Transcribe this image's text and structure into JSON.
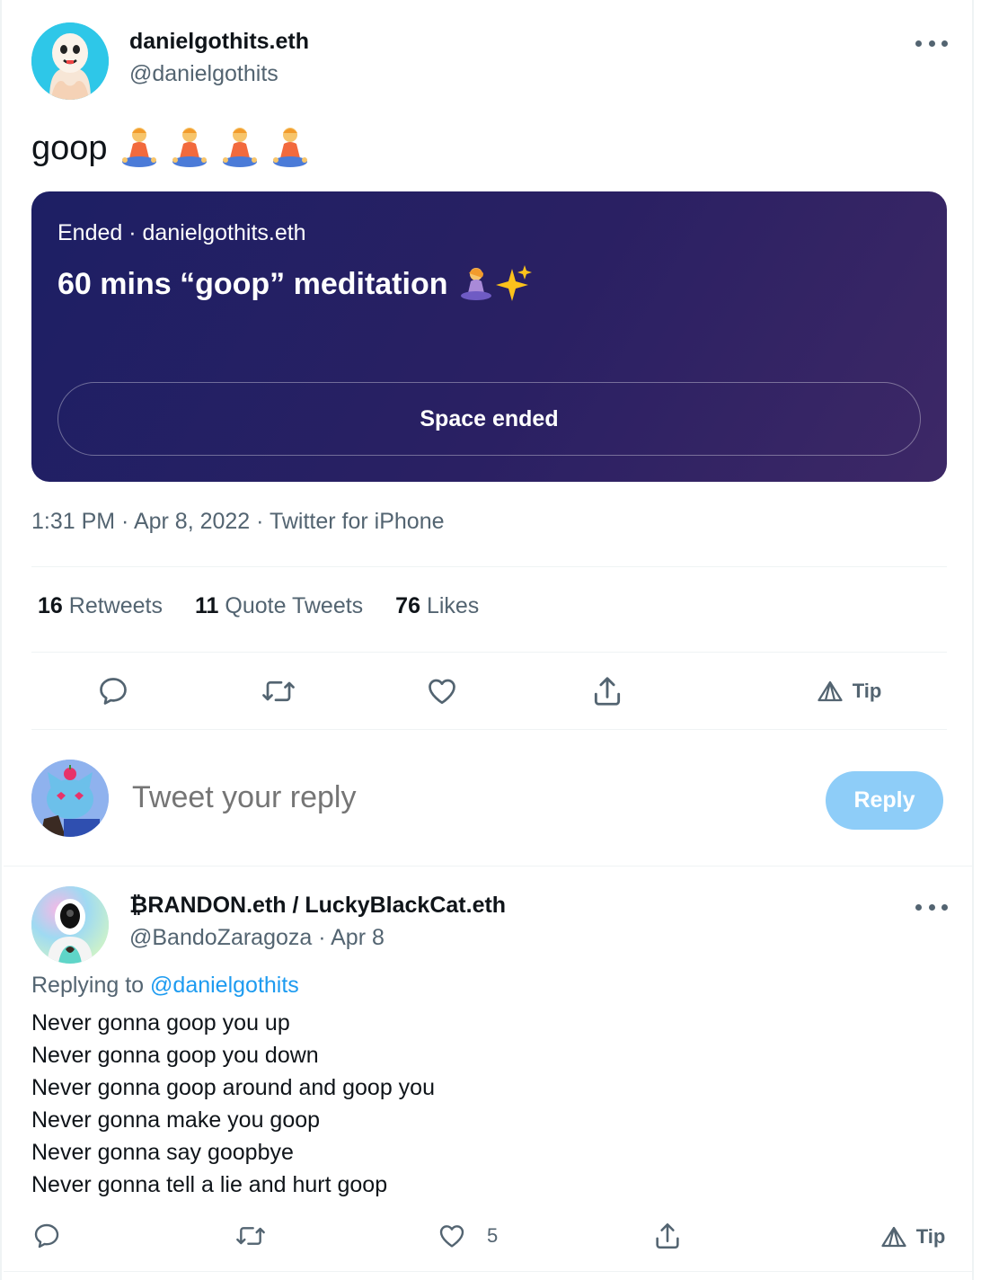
{
  "tweet": {
    "author_name": "danielgothits.eth",
    "author_handle": "@danielgothits",
    "text": "goop",
    "emoji_count": 4,
    "timestamp": "1:31 PM · Apr 8, 2022 · Twitter for iPhone",
    "stats": {
      "retweets_count": "16",
      "retweets_label": "Retweets",
      "quotes_count": "11",
      "quotes_label": "Quote Tweets",
      "likes_count": "76",
      "likes_label": "Likes"
    },
    "tip_label": "Tip"
  },
  "space": {
    "host_line": "Ended · danielgothits.eth",
    "title": "60 mins “goop” meditation",
    "button_label": "Space ended",
    "colors": {
      "start": "#1d1f64",
      "end": "#3d2866"
    }
  },
  "composer": {
    "placeholder": "Tweet your reply",
    "button_label": "Reply"
  },
  "reply": {
    "author_name": "₿RANDON.eth / LuckyBlackCat.eth",
    "author_handle_date": "@BandoZaragoza · Apr 8",
    "replying_prefix": "Replying to",
    "replying_to": "@danielgothits",
    "lines": [
      "Never gonna goop you up",
      "Never gonna goop you down",
      "Never gonna goop around and goop you",
      "Never gonna make you goop",
      "Never gonna say goopbye",
      "Never gonna tell a lie and hurt goop"
    ],
    "like_count": "5",
    "tip_label": "Tip"
  },
  "icons": [
    "more-icon",
    "meditation-emoji-icon",
    "sparkles-icon",
    "reply-icon",
    "retweet-icon",
    "like-icon",
    "share-icon",
    "tip-icon"
  ],
  "colors": {
    "accent": "#1d9bf0",
    "muted": "#536471",
    "reply_button": "#8ecdf8"
  }
}
